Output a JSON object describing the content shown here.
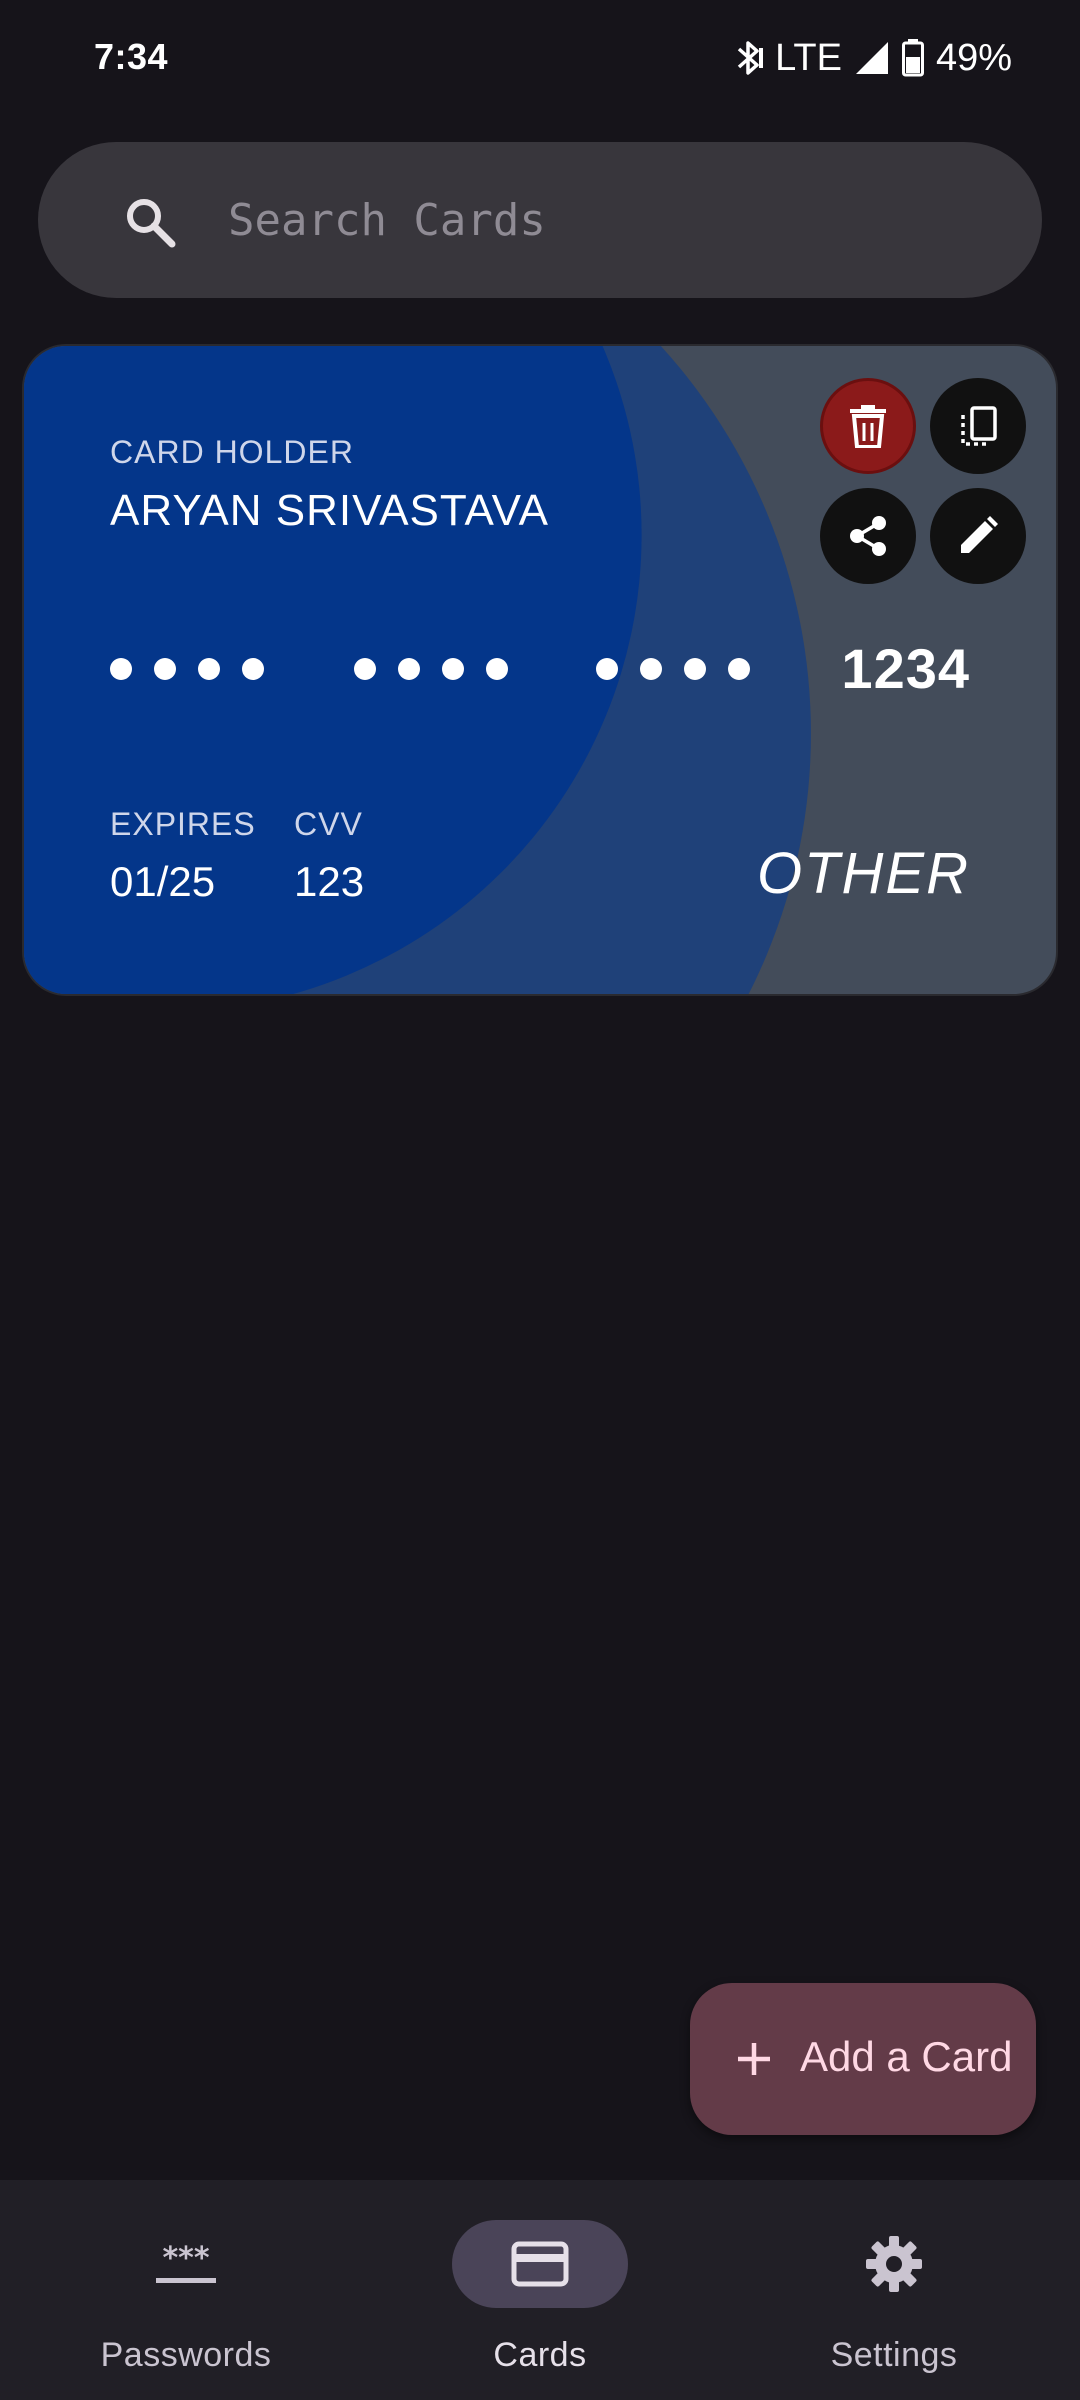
{
  "status_bar": {
    "time": "7:34",
    "network": "LTE",
    "battery": "49%"
  },
  "search": {
    "placeholder": "Search Cards"
  },
  "card": {
    "holder_label": "CARD HOLDER",
    "holder_name": "ARYAN SRIVASTAVA",
    "last4": "1234",
    "expires_label": "EXPIRES",
    "expires_value": "01/25",
    "cvv_label": "CVV",
    "cvv_value": "123",
    "type": "OTHER",
    "colors": {
      "primary": "#04368a",
      "secondary": "#1f4179",
      "base": "#434c5a"
    },
    "actions": [
      {
        "icon": "delete-icon",
        "color": "#8b1a1a"
      },
      {
        "icon": "copy-icon",
        "color": "#111111"
      },
      {
        "icon": "share-icon",
        "color": "#111111"
      },
      {
        "icon": "edit-icon",
        "color": "#111111"
      }
    ]
  },
  "fab": {
    "icon": "plus-icon",
    "label": "Add a Card",
    "color": "#633b48"
  },
  "bottom_nav": {
    "items": [
      {
        "label": "Passwords",
        "icon": "password-icon",
        "active": false
      },
      {
        "label": "Cards",
        "icon": "credit-card-icon",
        "active": true
      },
      {
        "label": "Settings",
        "icon": "gear-icon",
        "active": false
      }
    ]
  }
}
